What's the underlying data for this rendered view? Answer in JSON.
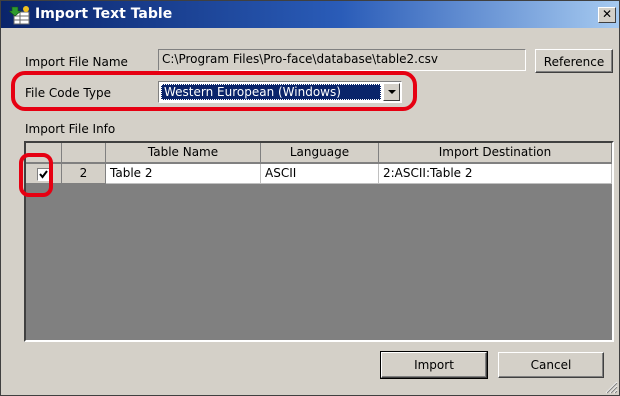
{
  "window": {
    "title": "Import Text Table"
  },
  "import_file_name": {
    "label": "Import File Name",
    "value": "C:\\Program Files\\Pro-face\\database\\table2.csv"
  },
  "reference_button": {
    "label": "Reference"
  },
  "file_code_type": {
    "label": "File Code Type",
    "selected": "Western European (Windows)"
  },
  "import_file_info": {
    "label": "Import File Info",
    "columns": [
      "Table Name",
      "Language",
      "Import Destination"
    ],
    "rows": [
      {
        "checked": true,
        "number": "2",
        "table_name": "Table 2",
        "language": "ASCII",
        "import_destination": "2:ASCII:Table 2"
      }
    ]
  },
  "buttons": {
    "import": "Import",
    "cancel": "Cancel"
  },
  "colors": {
    "title_bar": "#0a246a",
    "highlight": "#e60012",
    "face": "#d4d0c8",
    "grid_background": "#808080"
  }
}
